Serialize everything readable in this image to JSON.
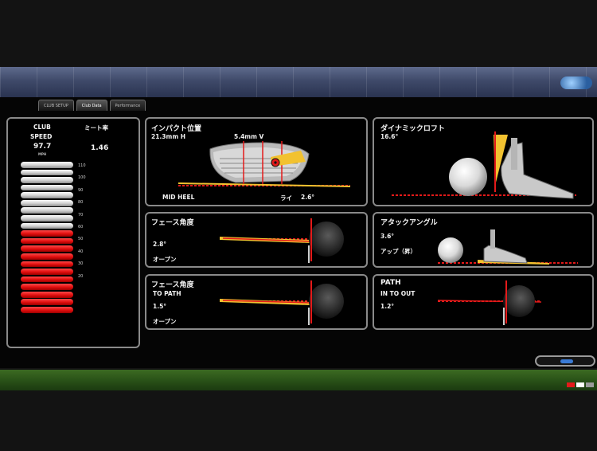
{
  "tabs": [
    "CLUB SETUP",
    "Club Data",
    "Performance"
  ],
  "club_panel": {
    "club_label": "CLUB",
    "speed_label": "SPEED",
    "speed_value": "97.7",
    "speed_unit": "MPH",
    "meet_label": "ミート率",
    "meet_value": "1.46",
    "ticks": [
      "110",
      "100",
      "90",
      "80",
      "70",
      "60",
      "50",
      "40",
      "30",
      "20"
    ],
    "gauge_white_segments": 9,
    "gauge_red_segments": 11
  },
  "impact": {
    "title": "インパクト位置",
    "h_value": "21.3mm H",
    "v_value": "5.4mm V",
    "location": "MID HEEL",
    "lie_label": "ライ",
    "lie_value": "2.6°"
  },
  "dynamic_loft": {
    "title": "ダイナミックロフト",
    "value": "16.6°"
  },
  "face_angle": {
    "title": "フェース角度",
    "value": "2.8°",
    "direction": "オープン"
  },
  "attack_angle": {
    "title": "アタックアングル",
    "value": "3.6°",
    "direction": "アップ（昇）"
  },
  "face_to_path": {
    "title": "フェース角度",
    "subtitle": "TO PATH",
    "value": "1.5°",
    "direction": "オープン"
  },
  "path": {
    "title": "PATH",
    "subtitle": "IN TO OUT",
    "value": "1.2°"
  },
  "colors": {
    "accent_red": "#e41a1a",
    "accent_yellow": "#f2c230",
    "panel_border": "#8a8a8a"
  }
}
